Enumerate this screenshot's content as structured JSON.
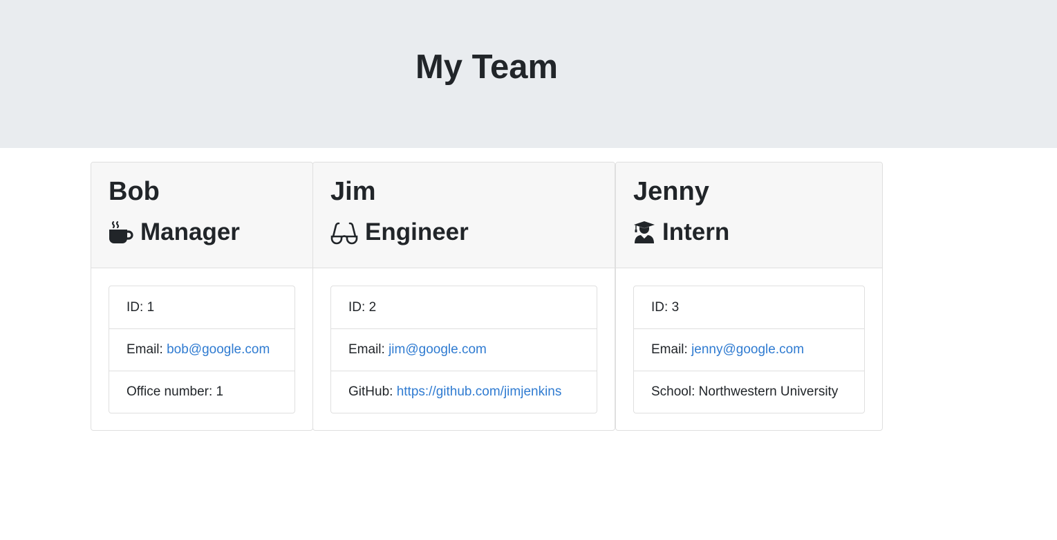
{
  "header": {
    "title": "My Team"
  },
  "employees": [
    {
      "name": "Bob",
      "role": "Manager",
      "icon": "coffee-mug-icon",
      "id_label": "ID: ",
      "id": "1",
      "email_label": "Email: ",
      "email": "bob@google.com",
      "extra_label": "Office number: ",
      "extra_value": "1"
    },
    {
      "name": "Jim",
      "role": "Engineer",
      "icon": "glasses-icon",
      "id_label": "ID: ",
      "id": "2",
      "email_label": "Email: ",
      "email": "jim@google.com",
      "extra_label": "GitHub: ",
      "extra_value": "https://github.com/jimjenkins"
    },
    {
      "name": "Jenny",
      "role": "Intern",
      "icon": "graduate-icon",
      "id_label": "ID: ",
      "id": "3",
      "email_label": "Email: ",
      "email": "jenny@google.com",
      "extra_label": "School: ",
      "extra_value": "Northwestern University"
    }
  ],
  "colors": {
    "header_bg": "#e9ecef",
    "card_header_bg": "#f7f7f7",
    "link": "#2f7bd1",
    "text": "#212529",
    "border": "#dfdfdf"
  }
}
